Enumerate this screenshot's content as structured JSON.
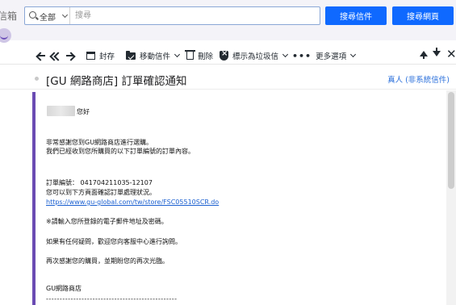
{
  "topbar": {
    "brand_fragment": "信箱",
    "search": {
      "scope_label": "全部",
      "placeholder": "搜尋",
      "value": ""
    },
    "search_mail_label": "搜尋信件",
    "search_web_label": "搜尋網頁"
  },
  "toolbar": {
    "archive_label": "封存",
    "move_label": "移動信件",
    "delete_label": "刪除",
    "spam_label": "標示為垃圾信",
    "more_label": "更多選項"
  },
  "message": {
    "subject": "[GU 網路商店] 訂單確認通知",
    "sender_tag": "真人 (非系統信件)",
    "greeting": "您好",
    "lines": [
      "非常感謝您到GU網路商店進行選購。",
      "我們已經收到您所購買的以下訂單編號的訂單內容。",
      "訂單編號： 041704211035-12107",
      "您可以到下方頁面確認訂單處理狀況。",
      "https://www.gu-global.com/tw/store/FSC05510SCR.do",
      "※請輸入您所登錄的電子郵件地址及密碼。",
      "如果有任何疑問，歡迎您向客服中心進行詢問。",
      "再次感謝您的購買，並期盼您的再次光臨。",
      "GU網路商店",
      "------------------------------------------------"
    ]
  },
  "colors": {
    "primary_button": "#0f69ff",
    "link": "#1a5fd0",
    "accent_bar": "#6a4bb3"
  }
}
